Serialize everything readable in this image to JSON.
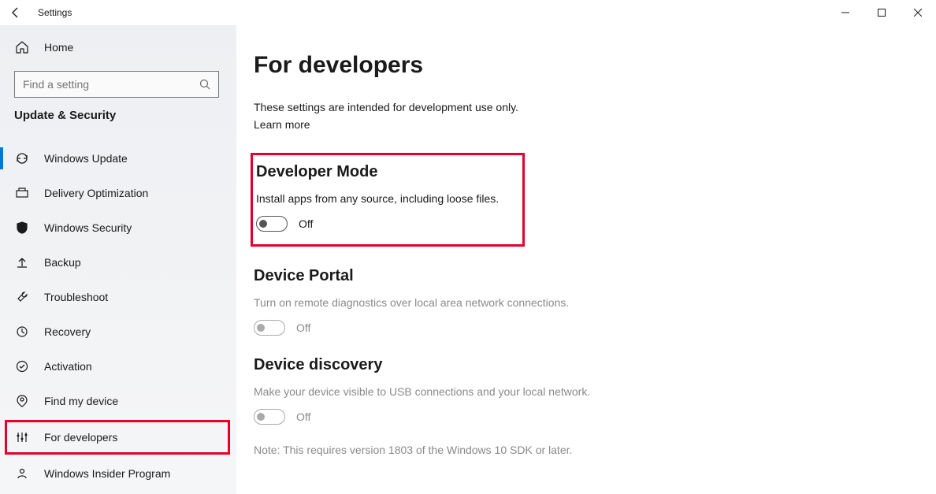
{
  "window": {
    "title": "Settings"
  },
  "sidebar": {
    "home_label": "Home",
    "search_placeholder": "Find a setting",
    "category_label": "Update & Security",
    "items": [
      {
        "label": "Windows Update"
      },
      {
        "label": "Delivery Optimization"
      },
      {
        "label": "Windows Security"
      },
      {
        "label": "Backup"
      },
      {
        "label": "Troubleshoot"
      },
      {
        "label": "Recovery"
      },
      {
        "label": "Activation"
      },
      {
        "label": "Find my device"
      },
      {
        "label": "For developers"
      },
      {
        "label": "Windows Insider Program"
      }
    ]
  },
  "main": {
    "title": "For developers",
    "intro": "These settings are intended for development use only.",
    "learn_more": "Learn more",
    "dev_mode": {
      "heading": "Developer Mode",
      "desc": "Install apps from any source, including loose files.",
      "state_label": "Off"
    },
    "device_portal": {
      "heading": "Device Portal",
      "desc": "Turn on remote diagnostics over local area network connections.",
      "state_label": "Off"
    },
    "device_discovery": {
      "heading": "Device discovery",
      "desc": "Make your device visible to USB connections and your local network.",
      "state_label": "Off",
      "note": "Note: This requires version 1803 of the Windows 10 SDK or later."
    }
  }
}
